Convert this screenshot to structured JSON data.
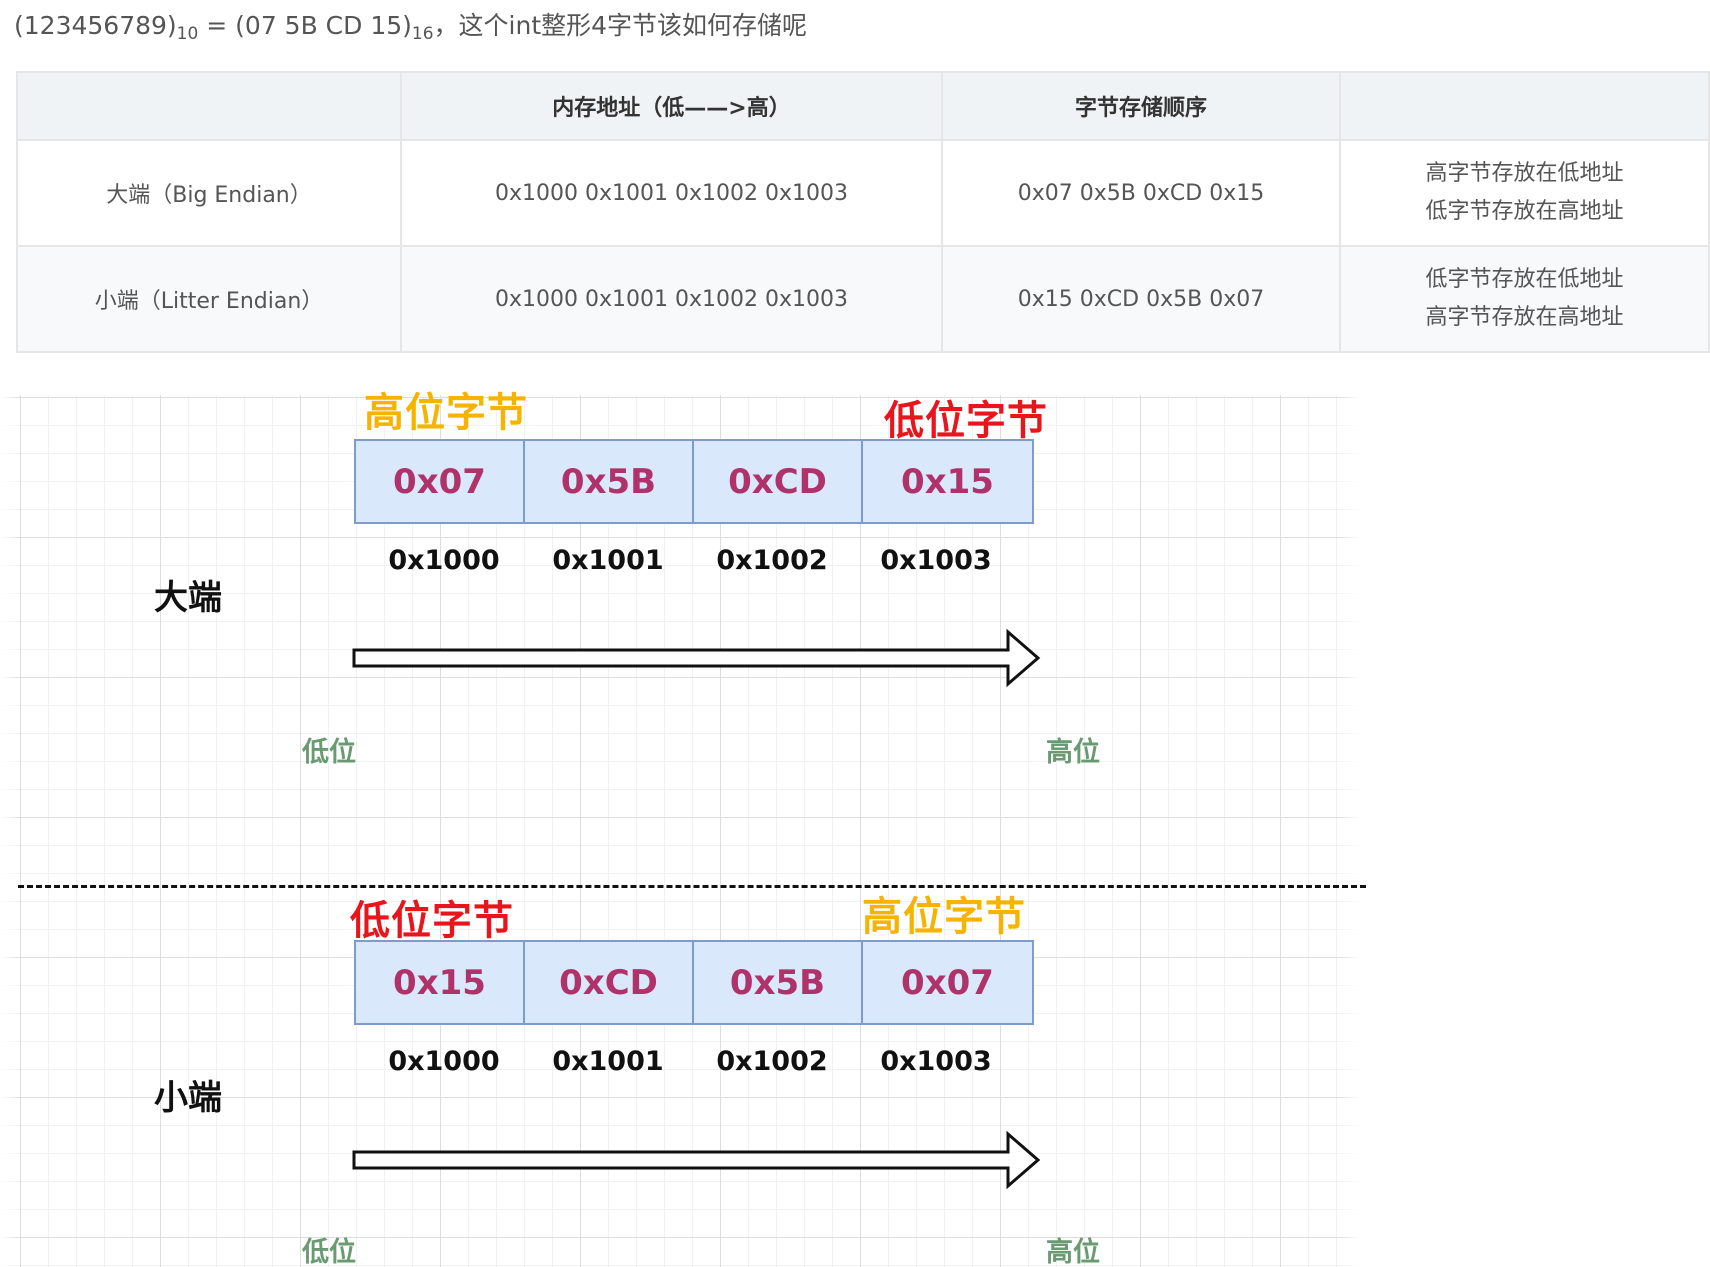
{
  "intro": {
    "dec_value": "(123456789)",
    "dec_base": "10",
    "equals": " = ",
    "hex_value": "(07 5B CD 15)",
    "hex_base": "16",
    "question": "，这个int整形4字节该如何存储呢"
  },
  "table": {
    "headers": [
      "",
      "内存地址（低——>高）",
      "字节存储顺序",
      ""
    ],
    "rows": [
      {
        "name": "大端（Big Endian）",
        "addresses": "0x1000 0x1001 0x1002 0x1003",
        "bytes": "0x07 0x5B 0xCD 0x15",
        "note_line1": "高字节存放在低地址",
        "note_line2": "低字节存放在高地址"
      },
      {
        "name": "小端（Litter Endian）",
        "addresses": "0x1000 0x1001 0x1002 0x1003",
        "bytes": "0x15 0xCD 0x5B 0x07",
        "note_line1": "低字节存放在低地址",
        "note_line2": "高字节存放在高地址"
      }
    ]
  },
  "colors": {
    "high_byte": "#f5b400",
    "low_byte": "#e8151c",
    "byte_text": "#b0326a",
    "cell_fill": "#dae8fc",
    "cell_border": "#7e9cc7",
    "position_text": "#6a9a72"
  },
  "diagram": {
    "big": {
      "label": "大端",
      "left_caption": "高位字节",
      "right_caption": "低位字节",
      "bytes": [
        "0x07",
        "0x5B",
        "0xCD",
        "0x15"
      ],
      "addresses": [
        "0x1000",
        "0x1001",
        "0x1002",
        "0x1003"
      ],
      "low_label": "低位",
      "high_label": "高位"
    },
    "little": {
      "label": "小端",
      "left_caption": "低位字节",
      "right_caption": "高位字节",
      "bytes": [
        "0x15",
        "0xCD",
        "0x5B",
        "0x07"
      ],
      "addresses": [
        "0x1000",
        "0x1001",
        "0x1002",
        "0x1003"
      ],
      "low_label": "低位",
      "high_label": "高位"
    }
  }
}
